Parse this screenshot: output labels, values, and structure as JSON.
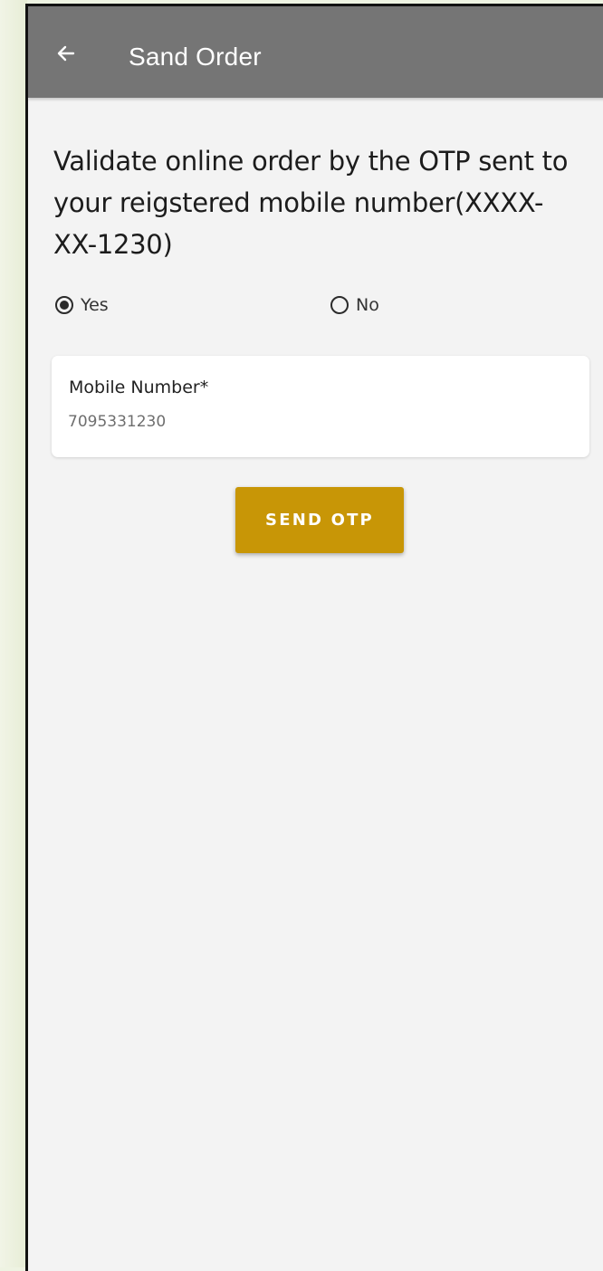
{
  "app_bar": {
    "title": "Sand Order",
    "back_icon": "arrow-left-icon",
    "background": "#757575"
  },
  "prompt": {
    "text": "Validate online order by the OTP sent to your reigstered mobile number(XXXX-XX-1230)"
  },
  "radio_group": {
    "options": [
      {
        "label": "Yes",
        "selected": true
      },
      {
        "label": "No",
        "selected": false
      }
    ]
  },
  "mobile_field": {
    "label": "Mobile Number*",
    "value": "7095331230"
  },
  "send_otp_button": {
    "label": "SEND OTP",
    "color": "#c89606"
  }
}
